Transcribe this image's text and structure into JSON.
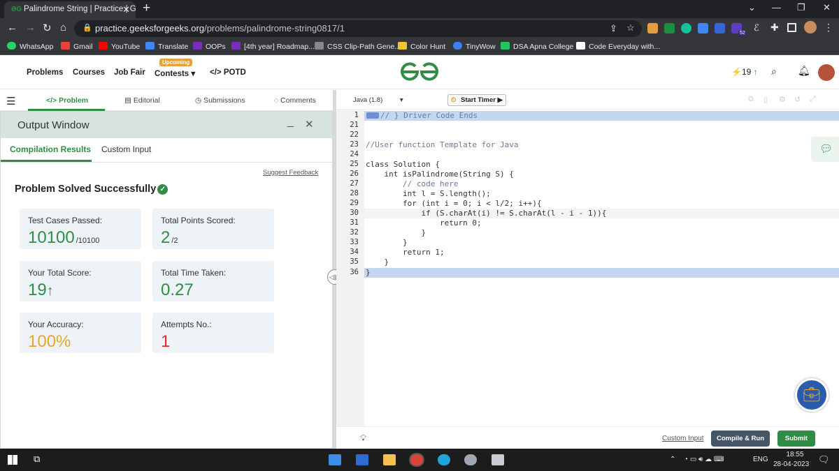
{
  "browser": {
    "tab_title": "Palindrome String | Practice | Gee",
    "url_host": "practice.geeksforgeeks.org",
    "url_path": "/problems/palindrome-string0817/1",
    "ext_badge": "52",
    "bookmarks": [
      {
        "label": "WhatsApp",
        "color": "#25d366"
      },
      {
        "label": "Gmail",
        "color": "#ea4335"
      },
      {
        "label": "YouTube",
        "color": "#ff0000"
      },
      {
        "label": "Translate",
        "color": "#4285f4"
      },
      {
        "label": "OOPs",
        "color": "#7b2cbf"
      },
      {
        "label": "[4th year] Roadmap...",
        "color": "#7b2cbf"
      },
      {
        "label": "CSS Clip-Path Gene...",
        "color": "#888888"
      },
      {
        "label": "Color Hunt",
        "color": "#f4c430"
      },
      {
        "label": "TinyWow",
        "color": "#3b82f6"
      },
      {
        "label": "DSA Apna College",
        "color": "#22c55e"
      },
      {
        "label": "Code Everyday with...",
        "color": "#ffffff"
      }
    ]
  },
  "header": {
    "nav": [
      "Problems",
      "Courses",
      "Job Fair",
      "Contests",
      "POTD"
    ],
    "badge": "Upcoming",
    "streak": "19",
    "accent": "#2f8d46"
  },
  "left_tabs": [
    "Problem",
    "Editorial",
    "Submissions",
    "Comments"
  ],
  "output": {
    "title": "Output Window",
    "tabs": [
      "Compilation Results",
      "Custom Input"
    ],
    "feedback": "Suggest Feedback",
    "status": "Problem Solved Successfully",
    "cards": [
      {
        "label": "Test Cases Passed:",
        "value": "10100",
        "sub": "/10100"
      },
      {
        "label": "Total Points Scored:",
        "value": "2",
        "sub": "/2"
      },
      {
        "label": "Your Total Score:",
        "value": "19",
        "sub": ""
      },
      {
        "label": "Total Time Taken:",
        "value": "0.27",
        "sub": ""
      },
      {
        "label": "Your Accuracy:",
        "value": "100%",
        "sub": ""
      },
      {
        "label": "Attempts No.:",
        "value": "1",
        "sub": ""
      }
    ]
  },
  "editor": {
    "language": "Java (1.8)",
    "timer": "Start Timer",
    "lines": [
      {
        "n": "1",
        "t": "// } Driver Code Ends"
      },
      {
        "n": "21",
        "t": ""
      },
      {
        "n": "22",
        "t": ""
      },
      {
        "n": "23",
        "t": "//User function Template for Java"
      },
      {
        "n": "24",
        "t": ""
      },
      {
        "n": "25",
        "t": "class Solution {"
      },
      {
        "n": "26",
        "t": "    int isPalindrome(String S) {"
      },
      {
        "n": "27",
        "t": "        // code here"
      },
      {
        "n": "28",
        "t": "        int l = S.length();"
      },
      {
        "n": "29",
        "t": "        for (int i = 0; i < l/2; i++){"
      },
      {
        "n": "30",
        "t": "            if (S.charAt(i) != S.charAt(l - i - 1)){"
      },
      {
        "n": "31",
        "t": "                return 0;"
      },
      {
        "n": "32",
        "t": "            }"
      },
      {
        "n": "33",
        "t": "        }"
      },
      {
        "n": "34",
        "t": "        return 1;"
      },
      {
        "n": "35",
        "t": "    }"
      },
      {
        "n": "36",
        "t": "}"
      }
    ],
    "custom_input": "Custom Input",
    "compile": "Compile & Run",
    "submit": "Submit"
  },
  "taskbar": {
    "lang": "ENG",
    "time": "18:55",
    "date": "28-04-2023"
  }
}
